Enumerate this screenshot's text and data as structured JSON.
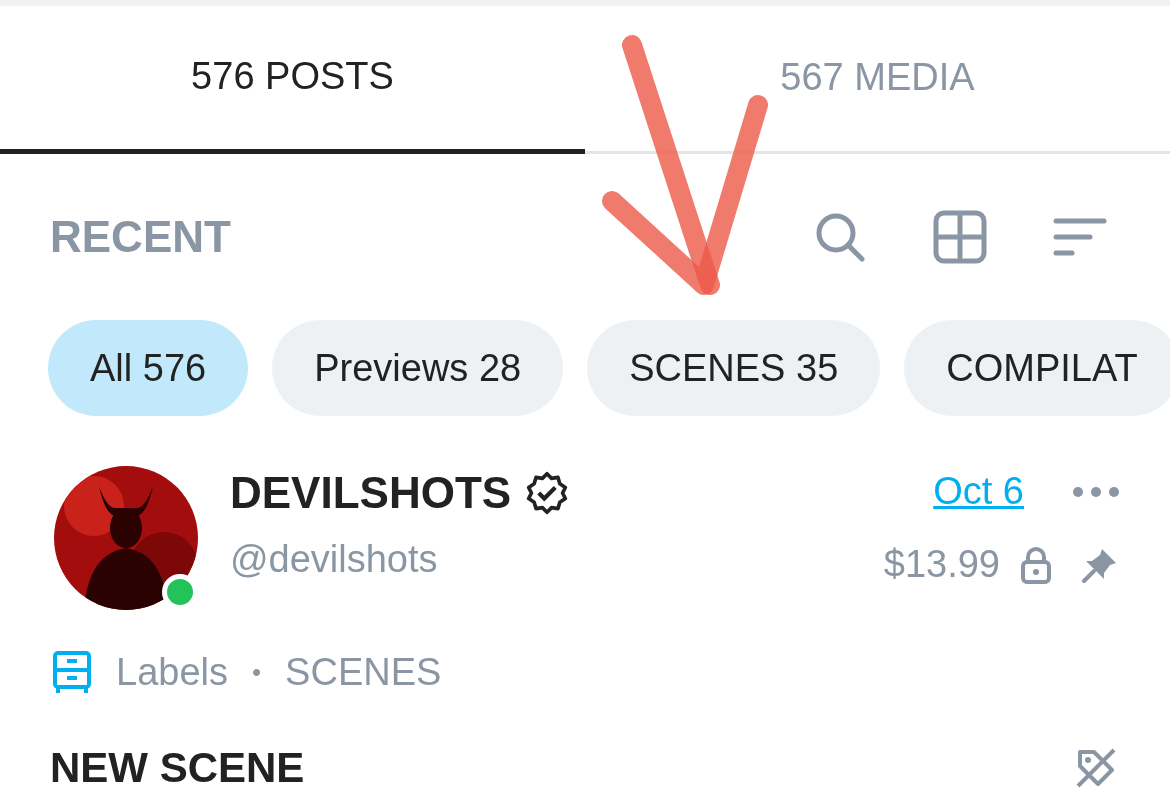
{
  "tabs": [
    {
      "label": "576 POSTS",
      "selected": true
    },
    {
      "label": "567 MEDIA",
      "selected": false
    }
  ],
  "section": {
    "title": "RECENT"
  },
  "filters": [
    {
      "label": "All 576",
      "selected": true
    },
    {
      "label": "Previews 28",
      "selected": false
    },
    {
      "label": "SCENES 35",
      "selected": false
    },
    {
      "label": "COMPILAT",
      "selected": false
    }
  ],
  "post": {
    "author": "DEVILSHOTS",
    "verified": true,
    "online": true,
    "handle": "@devilshots",
    "date": "Oct 6",
    "price": "$13.99",
    "locked": true,
    "pinned": true,
    "labels_caption": "Labels",
    "separator": "•",
    "labels": [
      "SCENES"
    ],
    "text": "NEW SCENE"
  }
}
